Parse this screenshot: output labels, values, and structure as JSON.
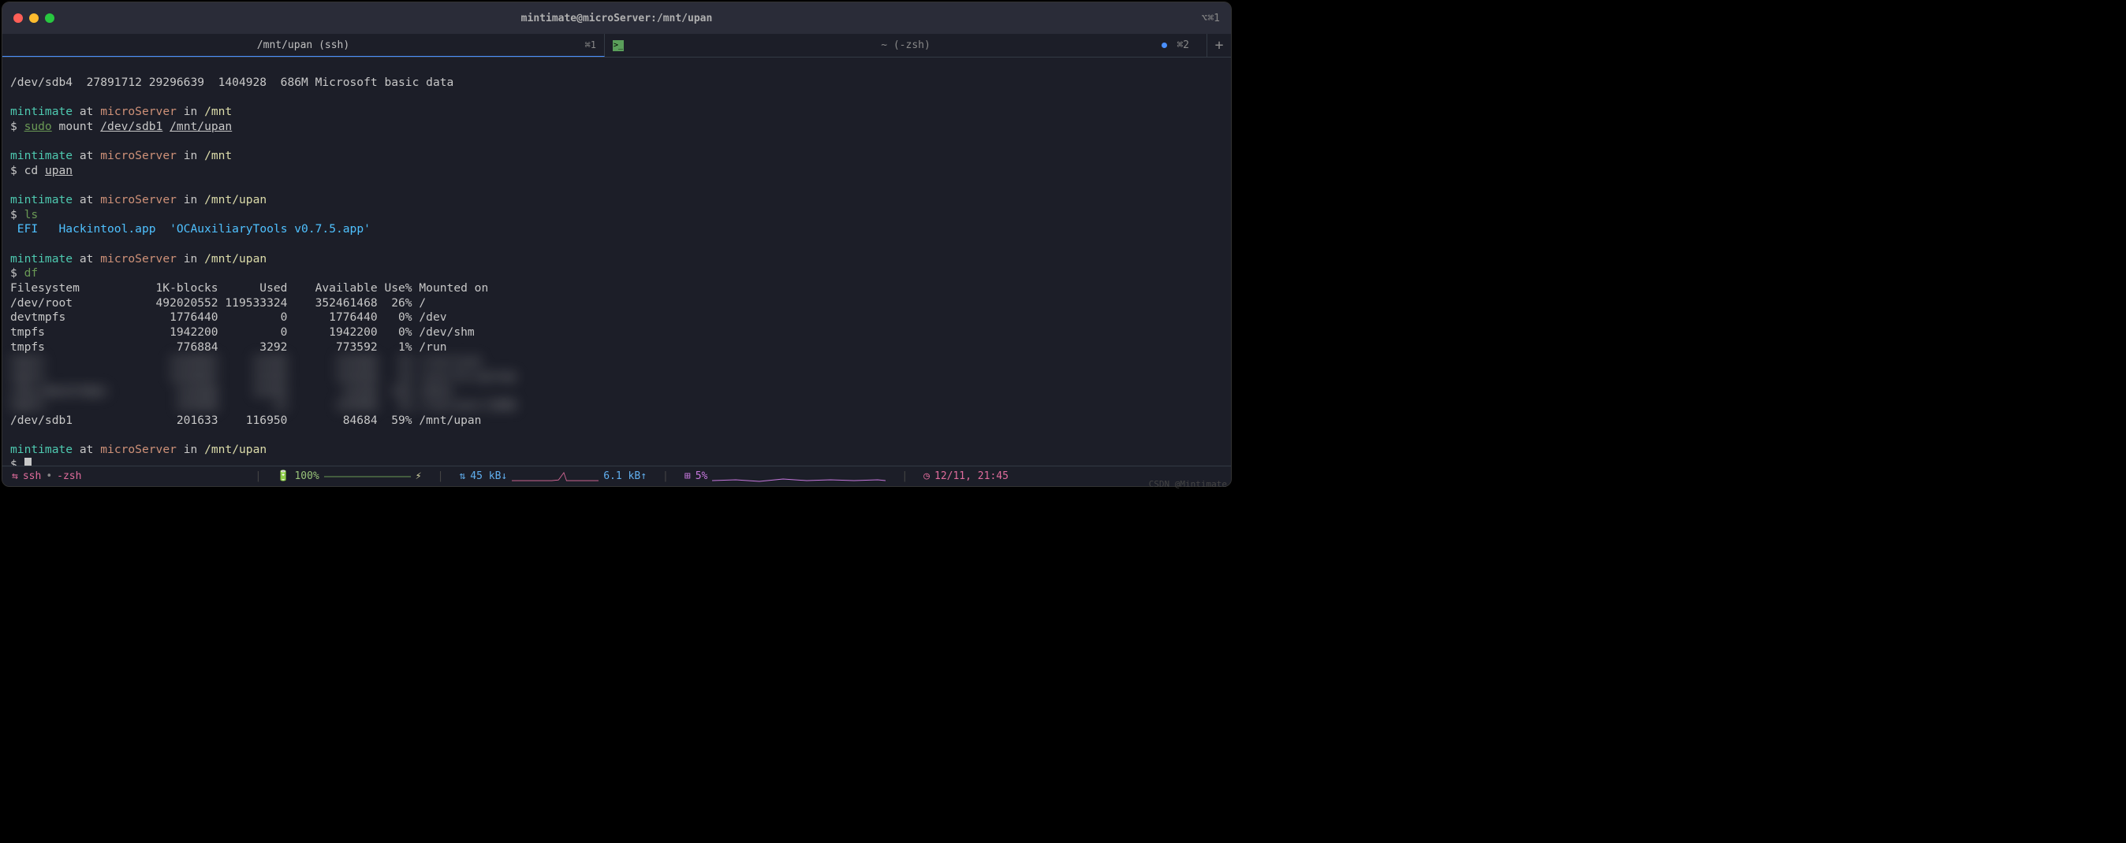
{
  "titlebar": {
    "title": "mintimate@microServer:/mnt/upan",
    "right": "⌥⌘1"
  },
  "tabs": [
    {
      "label": "/mnt/upan (ssh)",
      "shortcut": "⌘1",
      "active": true
    },
    {
      "label": "~ (-zsh)",
      "shortcut": "⌘2",
      "active": false
    }
  ],
  "prompt": {
    "user": "mintimate",
    "at": "at",
    "host": "microServer",
    "in": "in"
  },
  "lines": {
    "top_output": "/dev/sdb4  27891712 29296639  1404928  686M Microsoft basic data",
    "path_mnt": "/mnt",
    "path_upan": "/mnt/upan",
    "cmd_sudo": "sudo",
    "cmd_mount": "mount",
    "arg_dev": "/dev/sdb1",
    "arg_upan_path": "/mnt/upan",
    "cmd_cd": "cd",
    "arg_upan": "upan",
    "cmd_ls": "ls",
    "ls_efi": " EFI",
    "ls_hacktool": "Hackintool.app",
    "ls_ocaux": "'OCAuxiliaryTools v0.7.5.app'",
    "cmd_df": "df",
    "df_header": "Filesystem           1K-blocks      Used    Available Use% Mounted on",
    "df_row1": "/dev/root            492020552 119533324    352461468  26% /",
    "df_row2": "devtmpfs               1776440         0      1776440   0% /dev",
    "df_row3": "tmpfs                  1942200         0      1942200   0% /dev/shm",
    "df_row4": "tmpfs                   776884      3292       773592   1% /run",
    "df_blur": "tmpfs                  1234567     12345       123456   1% /run/lock     \ntmpfs                  1234567     12345       123456   1% /sys/fs/cgroup\n/dev/mmcblk0p1          123456     12345        12345  12% /boot         \ntmpfs                   123456        12       123456   1% /run/user/1000",
    "df_last": "/dev/sdb1               201633    116950        84684  59% /mnt/upan"
  },
  "statusbar": {
    "ssh": "ssh",
    "zsh": "-zsh",
    "battery": "100%",
    "net_down": "45 kB↓",
    "net_up": "6.1 kB↑",
    "cpu": "5%",
    "time": "12/11, 21:45"
  },
  "watermark": "CSDN @Mintimate"
}
